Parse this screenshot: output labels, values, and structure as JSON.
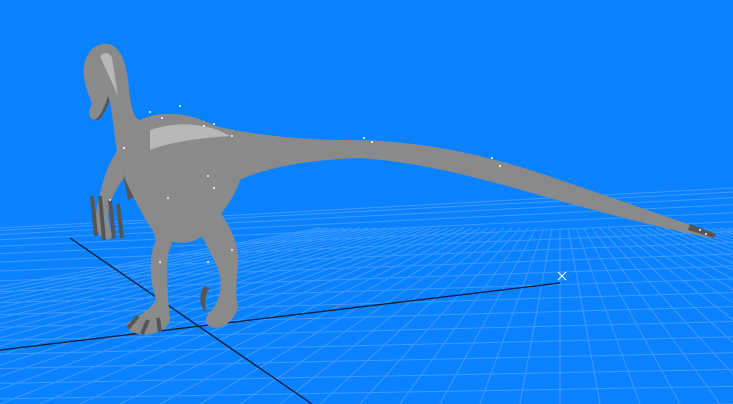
{
  "viewport": {
    "background_color": "#0a82ff",
    "grid_color": "#3d9bff",
    "axis_color": "#0a1a3a",
    "model_color": "#8a8a8a",
    "model_shadow_color": "#555555",
    "model_highlight_color": "#b8b8b8",
    "handle_color": "#ffffff",
    "icons": {
      "model": "velociraptor-model",
      "origin_marker": "x-axis-marker",
      "bone_handle": "dotted-handle-icon"
    }
  }
}
